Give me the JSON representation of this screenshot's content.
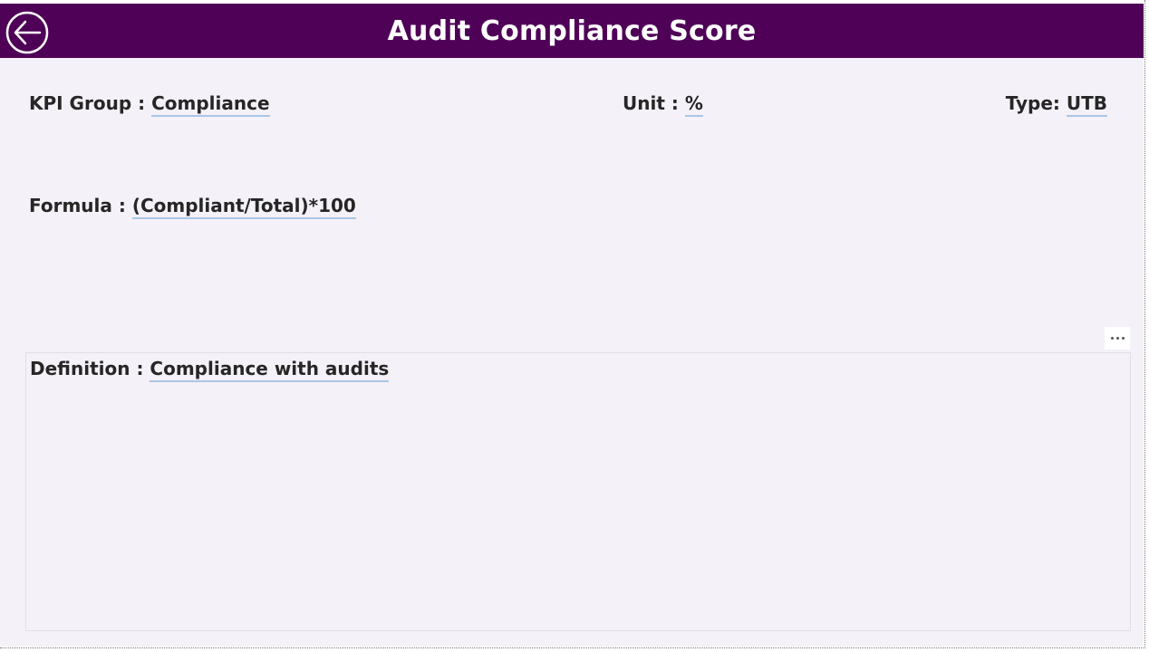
{
  "header": {
    "title": "Audit Compliance Score",
    "background_color": "#4f0057",
    "back_icon": "arrow-left-circle-icon"
  },
  "fields": {
    "kpi_group_label": "KPI Group :",
    "kpi_group_value": "Compliance",
    "unit_label": "Unit :",
    "unit_value": "%",
    "type_label": "Type:",
    "type_value": "UTB",
    "formula_label": "Formula :",
    "formula_value": "(Compliant/Total)*100",
    "definition_label": "Definition :",
    "definition_value": "Compliance with audits"
  },
  "visual_menu": {
    "icon": "more-options-icon"
  },
  "colors": {
    "canvas": "#f5f1f8",
    "underline": "#a9c6e6",
    "text": "#262626"
  }
}
